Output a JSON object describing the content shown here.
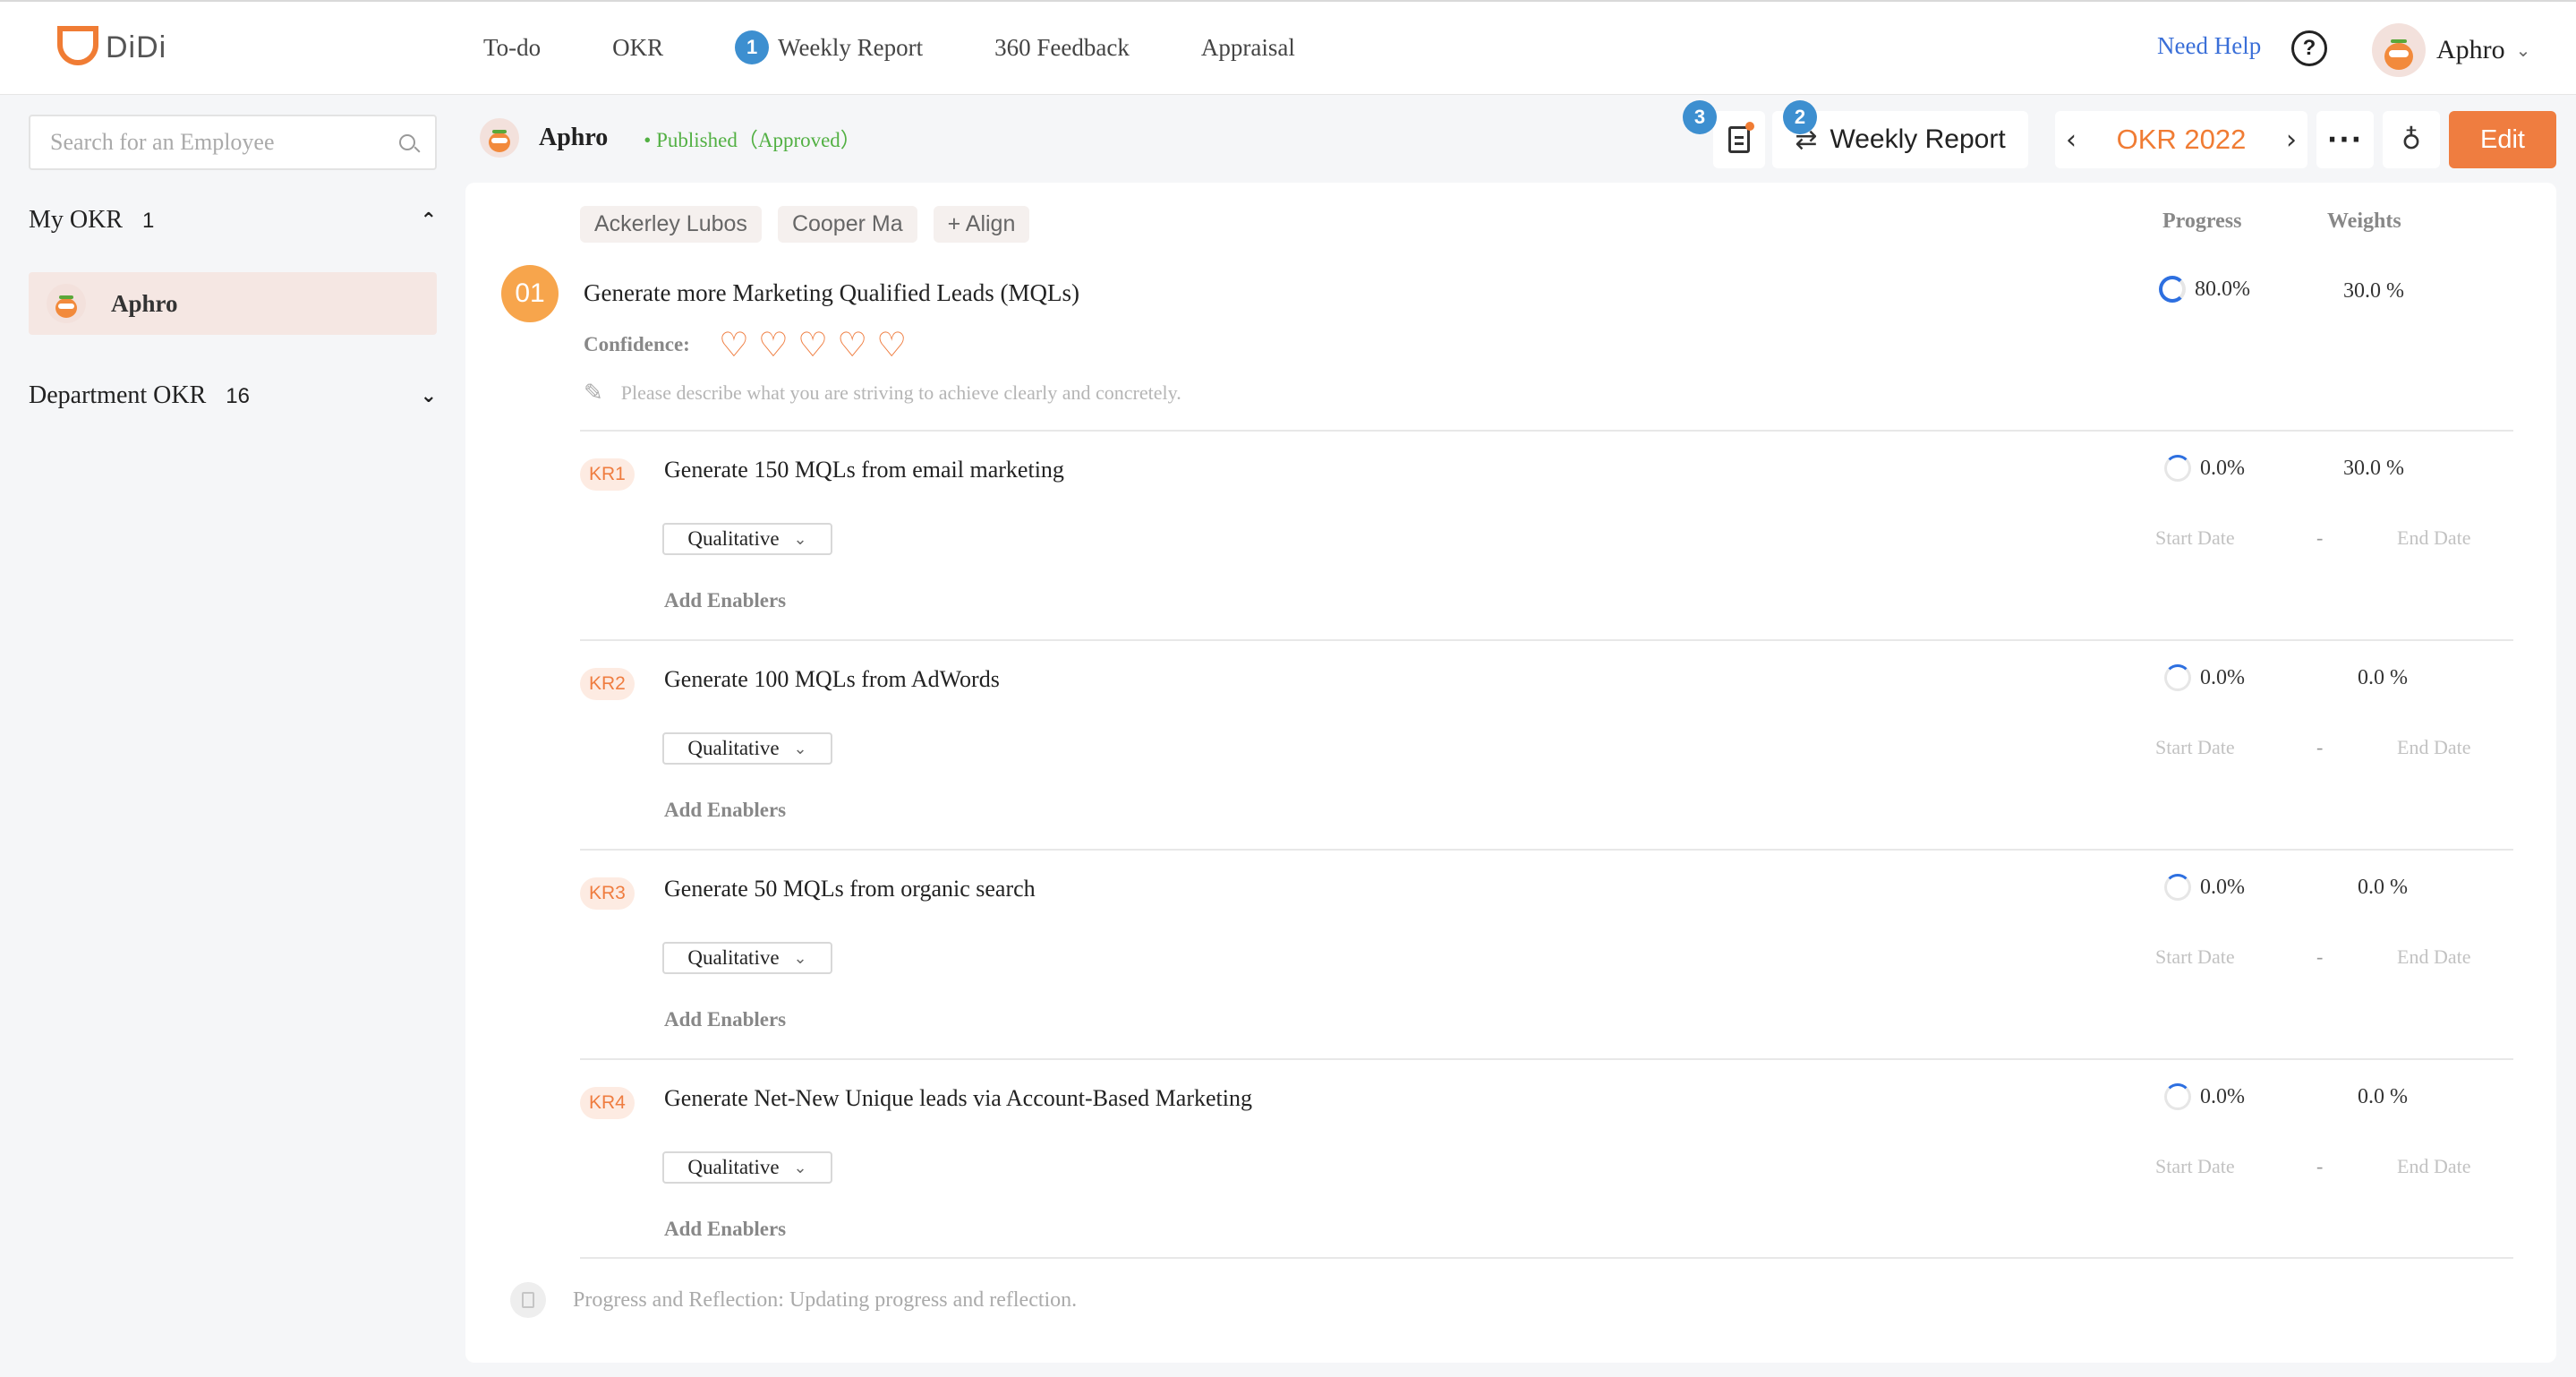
{
  "app": {
    "name": "DiDi"
  },
  "nav": {
    "items": [
      {
        "label": "To-do"
      },
      {
        "label": "OKR"
      },
      {
        "label": "Weekly Report",
        "badge": "1"
      },
      {
        "label": "360 Feedback"
      },
      {
        "label": "Appraisal"
      }
    ],
    "need_help": "Need Help",
    "help_glyph": "?",
    "user_name": "Aphro"
  },
  "sidebar": {
    "search_placeholder": "Search for an Employee",
    "my_okr": {
      "label": "My OKR",
      "count": "1",
      "expanded": true
    },
    "my_okr_item": "Aphro",
    "department_okr": {
      "label": "Department OKR",
      "count": "16",
      "expanded": false
    }
  },
  "header": {
    "user": "Aphro",
    "status": "• Published（Approved）",
    "doc_badge": "3",
    "weekly_badge": "2",
    "weekly_report": "Weekly Report",
    "okr_period": "OKR 2022",
    "edit": "Edit"
  },
  "okr": {
    "chips": [
      "Ackerley Lubos",
      "Cooper Ma",
      "+ Align"
    ],
    "col_progress": "Progress",
    "col_weights": "Weights",
    "objective": {
      "number": "01",
      "title": "Generate more Marketing Qualified Leads (MQLs)",
      "progress": "80.0%",
      "weight": "30.0 %",
      "confidence_label": "Confidence:",
      "confidence_hearts": 5,
      "description_placeholder": "Please describe what you are striving to achieve clearly and concretely."
    },
    "key_results": [
      {
        "tag": "KR1",
        "title": "Generate 150 MQLs from email marketing",
        "progress": "0.0%",
        "weight": "30.0 %",
        "type": "Qualitative",
        "start": "Start Date",
        "end": "End Date",
        "enablers": "Add Enablers"
      },
      {
        "tag": "KR2",
        "title": "Generate 100 MQLs from AdWords",
        "progress": "0.0%",
        "weight": "0.0 %",
        "type": "Qualitative",
        "start": "Start Date",
        "end": "End Date",
        "enablers": "Add Enablers"
      },
      {
        "tag": "KR3",
        "title": "Generate 50 MQLs from organic search",
        "progress": "0.0%",
        "weight": "0.0 %",
        "type": "Qualitative",
        "start": "Start Date",
        "end": "End Date",
        "enablers": "Add Enablers"
      },
      {
        "tag": "KR4",
        "title": "Generate Net-New Unique leads via Account-Based Marketing",
        "progress": "0.0%",
        "weight": "0.0 %",
        "type": "Qualitative",
        "start": "Start Date",
        "end": "End Date",
        "enablers": "Add Enablers"
      }
    ],
    "date_separator": "-",
    "reflection": "Progress and Reflection: Updating progress and reflection."
  },
  "colors": {
    "accent": "#ef7d40",
    "link": "#3a6fd8",
    "badge": "#3d8fd0",
    "status": "#52b043",
    "progress": "#2d6fe0"
  },
  "icons": [
    "search-icon",
    "help-icon",
    "chevron-down-icon",
    "chevron-up-icon",
    "document-icon",
    "cycle-icon",
    "chevron-left-icon",
    "chevron-right-icon",
    "more-icon",
    "lightbulb-icon",
    "heart-icon",
    "pen-icon",
    "progress-ring-icon",
    "reflection-icon"
  ]
}
